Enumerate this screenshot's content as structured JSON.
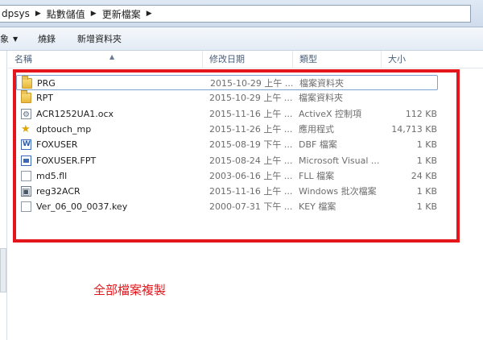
{
  "breadcrumbs": [
    "dpsys",
    "點數儲值",
    "更新檔案"
  ],
  "toolbar": {
    "organize_fragment": "象",
    "burn_label": "燒錄",
    "new_folder_label": "新增資料夾"
  },
  "columns": {
    "name": "名稱",
    "date": "修改日期",
    "type": "類型",
    "size": "大小"
  },
  "files": [
    {
      "name": "PRG",
      "date": "2015-10-29 上午 ...",
      "type": "檔案資料夾",
      "size": "",
      "icon": "folder-icon"
    },
    {
      "name": "RPT",
      "date": "2015-10-29 上午 ...",
      "type": "檔案資料夾",
      "size": "",
      "icon": "folder-icon"
    },
    {
      "name": "ACR1252UA1.ocx",
      "date": "2015-11-16 上午 ...",
      "type": "ActiveX 控制項",
      "size": "112 KB",
      "icon": "activex-icon"
    },
    {
      "name": "dptouch_mp",
      "date": "2015-11-26 上午 ...",
      "type": "應用程式",
      "size": "14,713 KB",
      "icon": "application-icon"
    },
    {
      "name": "FOXUSER",
      "date": "2015-08-19 下午 ...",
      "type": "DBF 檔案",
      "size": "1 KB",
      "icon": "dbf-file-icon"
    },
    {
      "name": "FOXUSER.FPT",
      "date": "2015-08-24 上午 ...",
      "type": "Microsoft Visual ...",
      "size": "1 KB",
      "icon": "fpt-file-icon"
    },
    {
      "name": "md5.fll",
      "date": "2003-06-16 上午 ...",
      "type": "FLL 檔案",
      "size": "24 KB",
      "icon": "blank-file-icon"
    },
    {
      "name": "reg32ACR",
      "date": "2015-11-16 上午 ...",
      "type": "Windows 批次檔案",
      "size": "1 KB",
      "icon": "batch-file-icon"
    },
    {
      "name": "Ver_06_00_0037.key",
      "date": "2000-07-31 下午 ...",
      "type": "KEY 檔案",
      "size": "1 KB",
      "icon": "blank-file-icon"
    }
  ],
  "annotation": "全部檔案複製",
  "colors": {
    "annotation_red": "#e4161c",
    "selection_border": "#7da2ce"
  }
}
